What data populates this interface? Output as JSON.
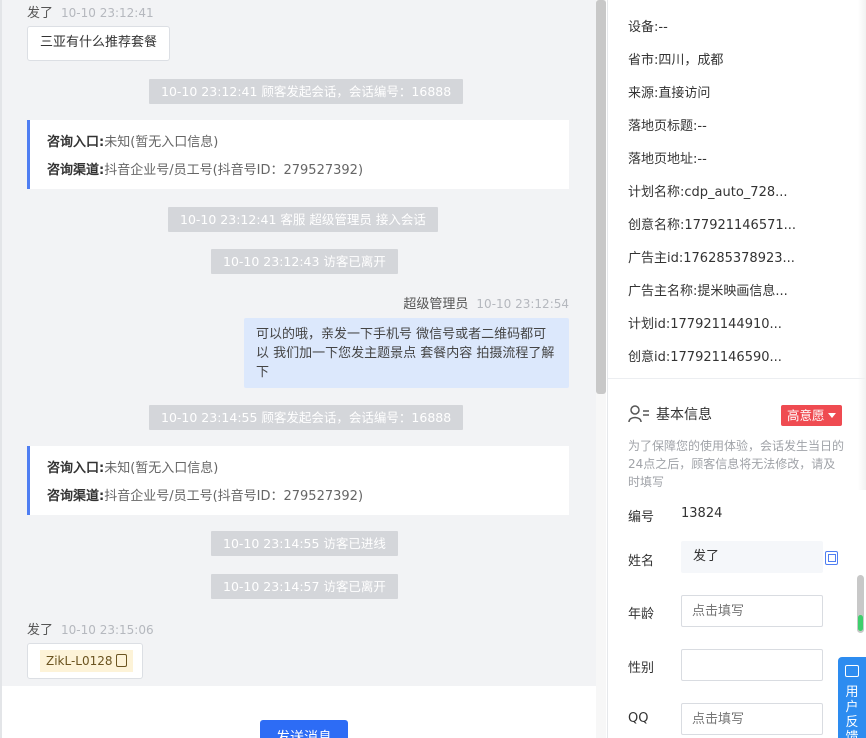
{
  "chat": {
    "msg1": {
      "sender": "发了",
      "time": "10-10 23:12:41",
      "text": "三亚有什么推荐套餐"
    },
    "sys1": "10-10 23:12:41 顾客发起会话，会话编号：16888",
    "card1": {
      "entry_label": "咨询入口:",
      "entry_value": "未知(暂无入口信息)",
      "channel_label": "咨询渠道:",
      "channel_value": "抖音企业号/员工号(抖音号ID：279527392)"
    },
    "sys2": "10-10 23:12:41 客服 超级管理员 接入会话",
    "sys3": "10-10 23:12:43 访客已离开",
    "agent_msg": {
      "sender": "超级管理员",
      "time": "10-10 23:12:54",
      "text": "可以的哦，亲发一下手机号 微信号或者二维码都可以 我们加一下您发主题景点 套餐内容 拍摄流程了解下"
    },
    "sys4": "10-10 23:14:55 顾客发起会话，会话编号：16888",
    "card2": {
      "entry_label": "咨询入口:",
      "entry_value": "未知(暂无入口信息)",
      "channel_label": "咨询渠道:",
      "channel_value": "抖音企业号/员工号(抖音号ID：279527392)"
    },
    "sys5": "10-10 23:14:55 访客已进线",
    "sys6": "10-10 23:14:57 访客已离开",
    "msg2": {
      "sender": "发了",
      "time": "10-10 23:15:06",
      "tag": "ZikL-L0128"
    },
    "send_label": "发送消息"
  },
  "panel": {
    "details": [
      {
        "label": "设备:",
        "value": "--"
      },
      {
        "label": "省市:",
        "value": "四川，成都"
      },
      {
        "label": "来源:",
        "value": "直接访问"
      },
      {
        "label": "落地页标题:",
        "value": "--"
      },
      {
        "label": "落地页地址:",
        "value": "--"
      },
      {
        "label": "计划名称:",
        "value": "cdp_auto_728..."
      },
      {
        "label": "创意名称:",
        "value": "177921146571..."
      },
      {
        "label": "广告主id:",
        "value": "176285378923..."
      },
      {
        "label": "广告主名称:",
        "value": "提米映画信息..."
      },
      {
        "label": "计划id:",
        "value": "177921144910..."
      },
      {
        "label": "创意id:",
        "value": "177921146590..."
      }
    ],
    "basic_title": "基本信息",
    "intent_badge": "高意愿",
    "notice": "为了保障您的使用体验，会话发生当日的24点之后，顾客信息将无法修改，请及时填写",
    "fields": {
      "id_label": "编号",
      "id_value": "13824",
      "name_label": "姓名",
      "name_value": "发了",
      "age_label": "年龄",
      "age_placeholder": "点击填写",
      "gender_label": "性别",
      "qq_label": "QQ",
      "qq_placeholder": "点击填写"
    },
    "feedback": "用户反馈"
  },
  "colors": {
    "accent": "#2d6cf5",
    "intent": "#ef4b51",
    "card_border": "#4f7ef2",
    "agent_bubble": "#dce8fc",
    "system_bg": "#d4d6da"
  }
}
